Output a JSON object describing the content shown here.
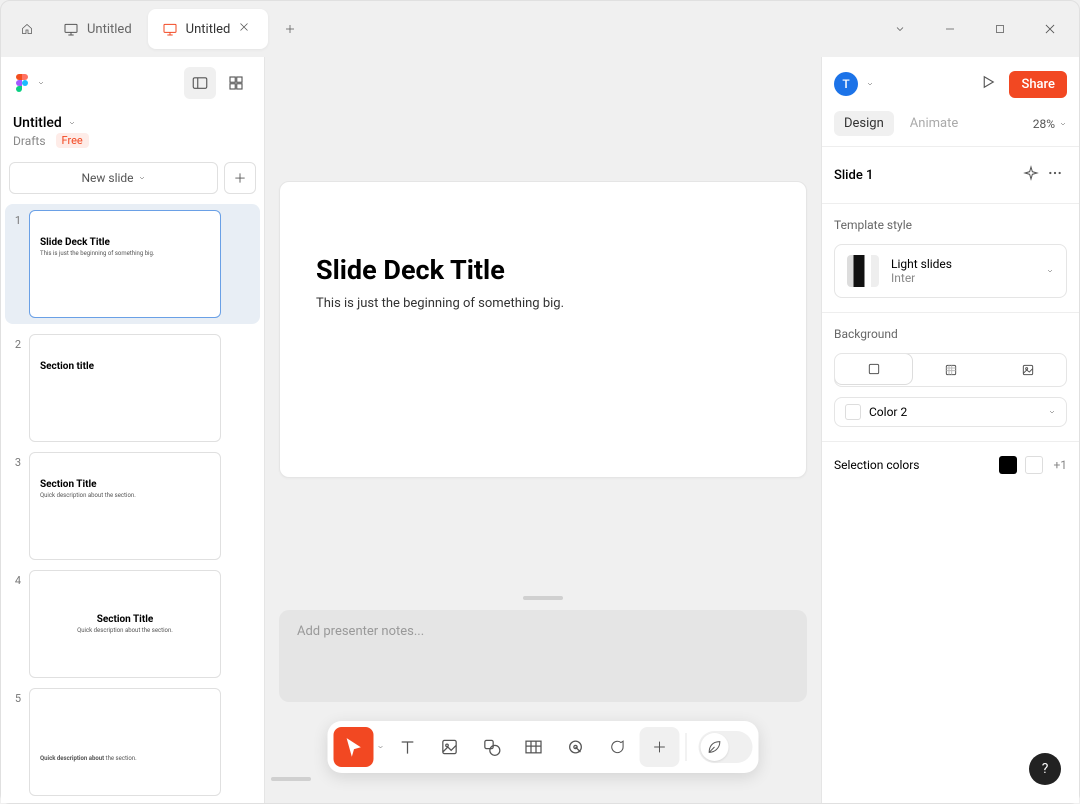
{
  "titlebar": {
    "tab1_label": "Untitled",
    "tab2_label": "Untitled"
  },
  "left_sidebar": {
    "project_name": "Untitled",
    "breadcrumb": "Drafts",
    "plan_badge": "Free",
    "new_slide_label": "New slide"
  },
  "thumbs": [
    {
      "num": "1",
      "title": "Slide Deck Title",
      "sub": "This is just the beginning of something big.",
      "centered": false
    },
    {
      "num": "2",
      "title": "Section title",
      "sub": "",
      "centered": false
    },
    {
      "num": "3",
      "title": "Section Title",
      "sub": "Quick description about the section.",
      "centered": false
    },
    {
      "num": "4",
      "title": "Section Title",
      "sub": "Quick description about the section.",
      "centered": true
    },
    {
      "num": "5",
      "title": "",
      "sub": "Quick description about the section.",
      "centered": false
    }
  ],
  "slide": {
    "title": "Slide Deck Title",
    "subtitle": "This is just the beginning of something big."
  },
  "notes_placeholder": "Add presenter notes...",
  "right_sidebar": {
    "avatar_initial": "T",
    "share_label": "Share",
    "design_tab": "Design",
    "animate_tab": "Animate",
    "zoom": "28%",
    "slide_label": "Slide 1",
    "template_header": "Template style",
    "template_name": "Light slides",
    "template_font": "Inter",
    "background_header": "Background",
    "color_label": "Color 2",
    "selection_colors_label": "Selection colors",
    "plus_count": "+1"
  },
  "help_label": "?"
}
